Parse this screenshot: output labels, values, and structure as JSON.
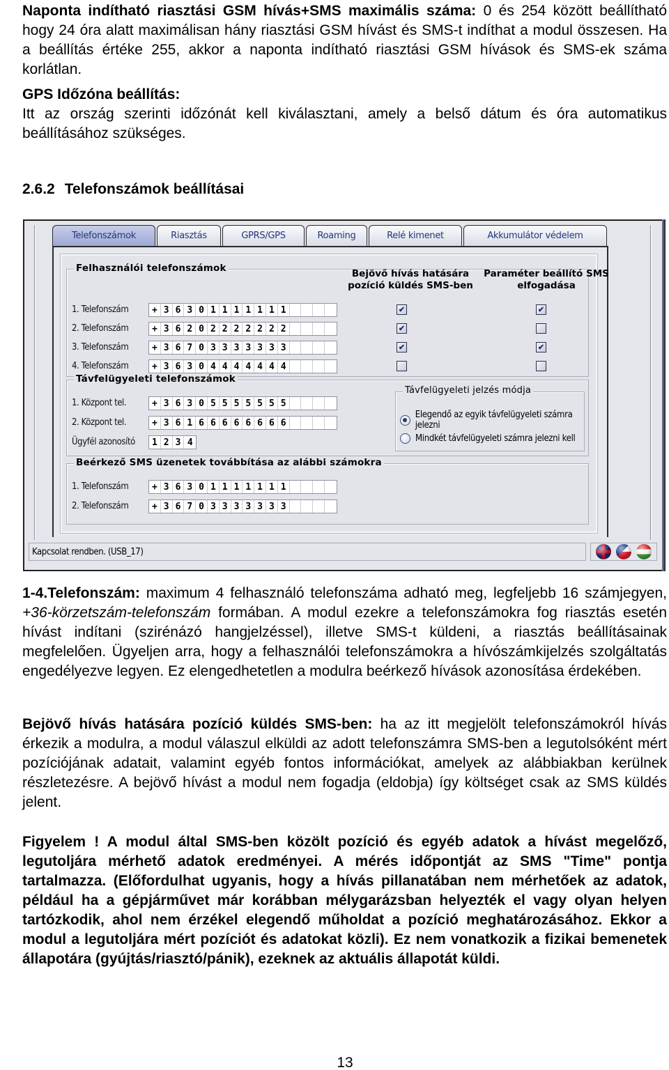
{
  "intro": {
    "p1_bold": "Naponta indítható riasztási GSM hívás+SMS maximális száma:",
    "p1_text": " 0 és 254 között beállítható hogy 24 óra alatt maximálisan hány riasztási GSM hívást és SMS-t indíthat a modul összesen. Ha a beállítás értéke 255, akkor a naponta indítható riasztási GSM hívások és SMS-ek száma korlátlan.",
    "p2_bold": "GPS Időzóna beállítás:",
    "p2_text": "Itt az ország szerinti időzónát kell kiválasztani, amely a belső dátum és óra automatikus beállításához szükséges."
  },
  "section": {
    "number": "2.6.2",
    "title": "Telefonszámok beállításai"
  },
  "window": {
    "tabs": [
      {
        "label": "Telefonszámok",
        "active": true
      },
      {
        "label": "Riasztás",
        "active": false
      },
      {
        "label": "GPRS/GPS",
        "active": false
      },
      {
        "label": "Roaming",
        "active": false
      },
      {
        "label": "Relé kimenet",
        "active": false
      },
      {
        "label": "Akkumulátor védelem",
        "active": false
      }
    ],
    "user_numbers": {
      "title": "Felhasználói telefonszámok",
      "col_position": "Bejövő hívás hatására pozíció küldés SMS-ben",
      "col_position_l1": "Bejövő hívás hatására",
      "col_position_l2": "pozíció küldés SMS-ben",
      "col_sms_l1": "Paraméter beállító SMS",
      "col_sms_l2": "elfogadása",
      "rows": [
        {
          "label": "1. Telefonszám",
          "value": "+36301111111",
          "position_sms": true,
          "accept_sms": true
        },
        {
          "label": "2. Telefonszám",
          "value": "+36202222222",
          "position_sms": true,
          "accept_sms": false
        },
        {
          "label": "3. Telefonszám",
          "value": "+36703333333",
          "position_sms": true,
          "accept_sms": true
        },
        {
          "label": "4. Telefonszám",
          "value": "+36304444444",
          "position_sms": false,
          "accept_sms": false
        }
      ]
    },
    "remote_numbers": {
      "title": "Távfelügyeleti telefonszámok",
      "rows": [
        {
          "label": "1. Központ tel.",
          "value": "+36305555555"
        },
        {
          "label": "2. Központ tel.",
          "value": "+36166666666"
        }
      ],
      "client_id_label": "Ügyfél azonosító",
      "client_id": "1234",
      "mode": {
        "title": "Távfelügyeleti jelzés módja",
        "options": [
          {
            "label": "Elegendő az egyik távfelügyeleti számra jelezni",
            "selected": true
          },
          {
            "label": "Mindkét távfelügyeleti számra jelezni kell",
            "selected": false
          }
        ]
      }
    },
    "forward_sms": {
      "title": "Beérkező SMS üzenetek továbbítása az alábbi számokra",
      "rows": [
        {
          "label": "1. Telefonszám",
          "value": "+36301111111"
        },
        {
          "label": "2. Telefonszám",
          "value": "+36703333333"
        }
      ]
    },
    "status": "Kapcsolat rendben. (USB_17)",
    "languages": [
      "uk-flag",
      "czech-flag",
      "hungarian-flag"
    ]
  },
  "body": {
    "p3_bold": "1-4.Telefonszám:",
    "p3_text_a": " maximum 4 felhasználó telefonszáma adható meg, legfeljebb 16 számjegyen, ",
    "p3_italic": "+36-körzetszám-telefonszám",
    "p3_text_b": " formában. A modul ezekre a telefonszámokra fog  riasztás esetén hívást indítani (szirénázó hangjelzéssel), illetve SMS-t küldeni, a riasztás beállításainak megfelelően. Ügyeljen arra, hogy a felhasználói telefonszámokra a hívószámkijelzés szolgáltatás engedélyezve legyen. Ez elengedhetetlen a modulra beérkező hívások azonosítása érdekében.",
    "p4_bold": "Bejövő hívás hatására pozíció küldés SMS-ben:",
    "p4_text": " ha az itt megjelölt telefonszámokról hívás érkezik a modulra, a modul válaszul elküldi az adott telefonszámra SMS-ben a legutolsóként mért pozíciójának adatait, valamint egyéb fontos információkat, amelyek az alábbiakban kerülnek részletezésre. A bejövő hívást a modul nem fogadja (eldobja) így költséget csak az SMS küldés jelent.",
    "p5_bold": "Figyelem ! A modul által SMS-ben közölt pozíció és egyéb adatok a hívást megelőző, legutoljára mérhető adatok eredményei. A mérés időpontját az SMS \"Time\" pontja tartalmazza. (Előfordulhat ugyanis, hogy a hívás pillanatában nem mérhetőek az adatok, például ha a gépjárművet már korábban mélygarázsban helyezték el vagy olyan helyen tartózkodik, ahol nem érzékel elegendő műholdat a pozíció meghatározásához. Ekkor a modul a legutoljára mért pozíciót és adatokat közli). Ez nem vonatkozik a fizikai bemenetek állapotára (gyújtás/riasztó/pánik), ezeknek az aktuális állapotát küldi."
  },
  "page_number": "13"
}
